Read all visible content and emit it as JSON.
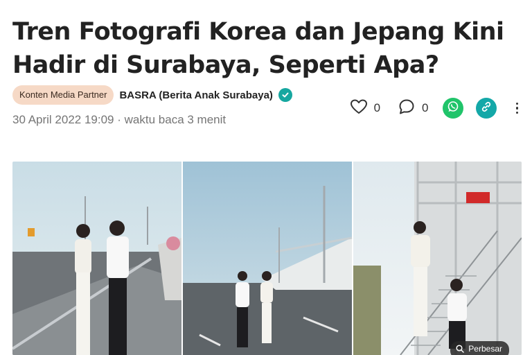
{
  "article": {
    "title": "Tren Fotografi Korea dan Jepang Kini Hadir di Surabaya, Seperti Apa?",
    "badge": "Konten Media Partner",
    "publisher": "BASRA (Berita Anak Surabaya)",
    "date": "30 April 2022 19:09",
    "separator": "·",
    "read_time": "waktu baca 3 menit"
  },
  "actions": {
    "likes": "0",
    "comments": "0"
  },
  "photo": {
    "zoom_label": "Perbesar"
  },
  "colors": {
    "badge_bg": "#f6d9c6",
    "verified": "#16a7a0",
    "whatsapp": "#20c46a",
    "link": "#14a8a8"
  },
  "icons": [
    "verified-icon",
    "heart-icon",
    "comment-icon",
    "whatsapp-icon",
    "link-icon",
    "more-icon",
    "zoom-icon"
  ]
}
